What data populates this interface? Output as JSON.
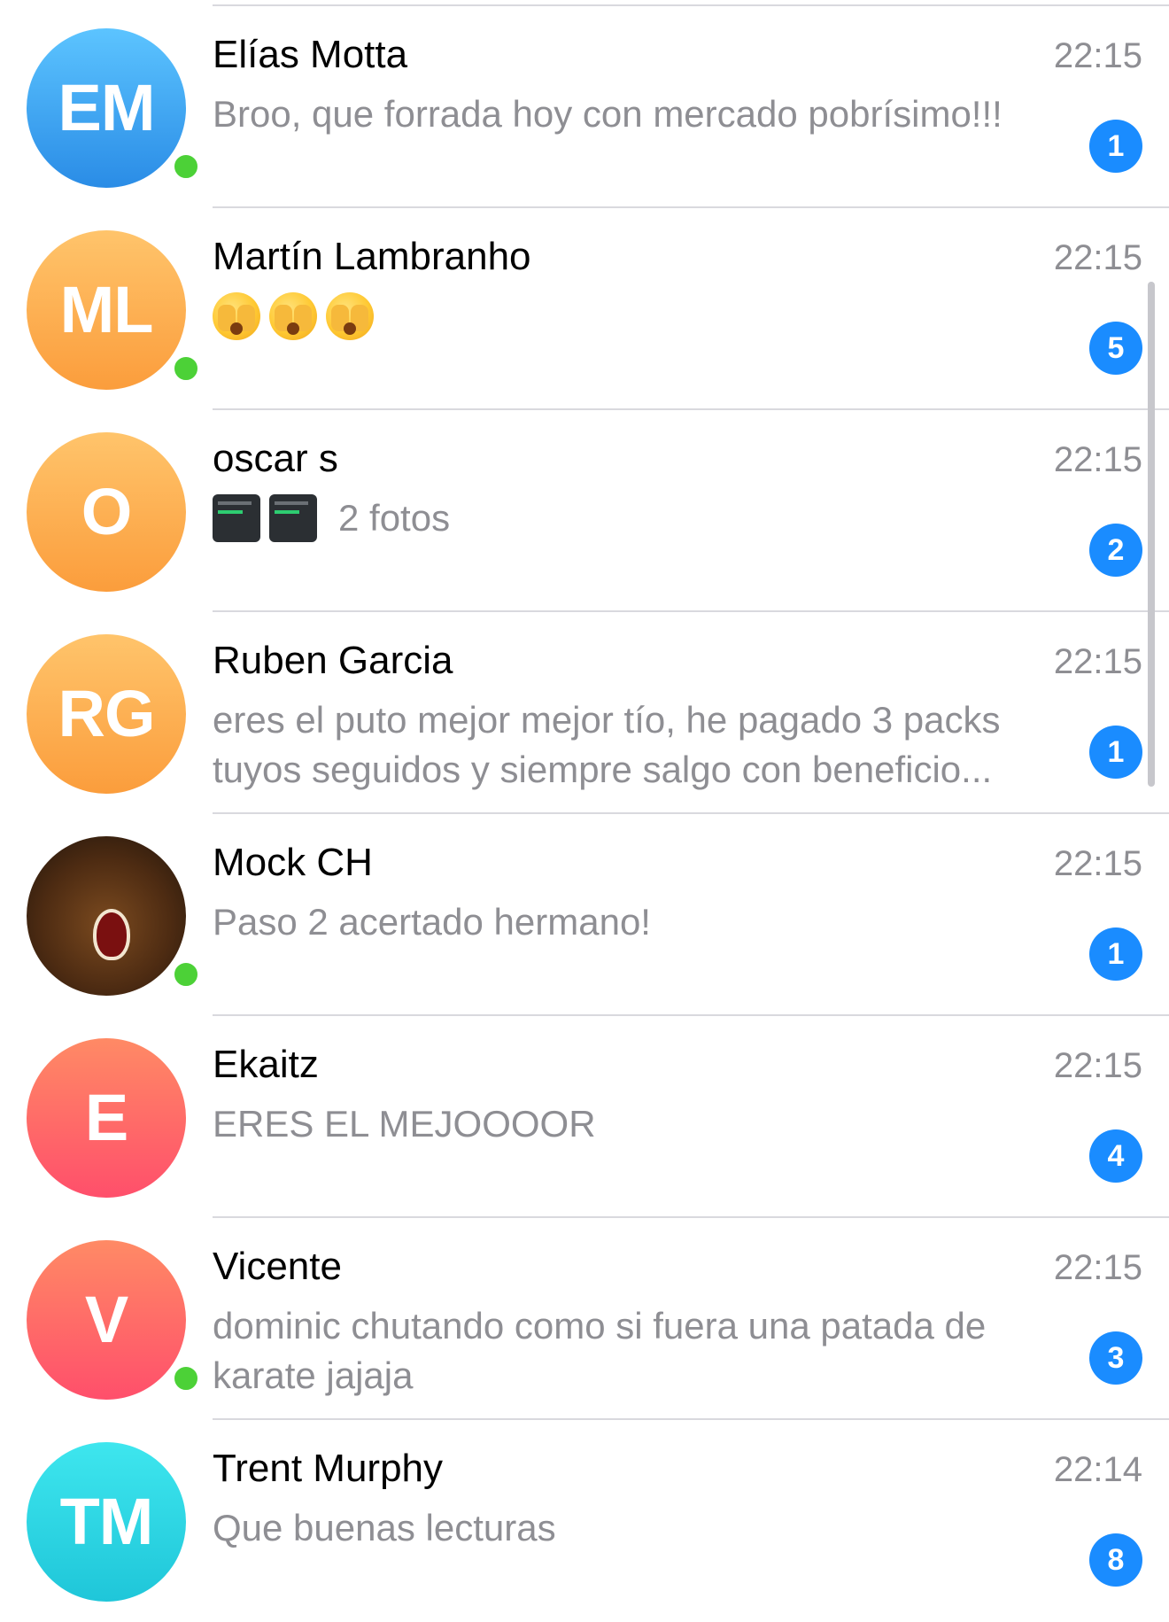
{
  "chats": [
    {
      "name": "Elías Motta",
      "time": "22:15",
      "preview": "Broo, que forrada hoy con mercado pobrísimo!!!",
      "initials": "EM",
      "avatar_color_top": "#5cc4ff",
      "avatar_color_bottom": "#2a8ce6",
      "online": true,
      "unread": "1"
    },
    {
      "name": "Martín Lambranho",
      "time": "22:15",
      "preview_emoji": [
        "face-with-hands-over-eyes-emoji",
        "face-with-hands-over-eyes-emoji",
        "face-with-hands-over-eyes-emoji"
      ],
      "initials": "ML",
      "avatar_color_top": "#ffc46b",
      "avatar_color_bottom": "#fb9d3c",
      "online": true,
      "unread": "5"
    },
    {
      "name": "oscar s",
      "time": "22:15",
      "preview": "2 fotos",
      "preview_thumbnails": 2,
      "initials": "O",
      "avatar_color_top": "#ffc46b",
      "avatar_color_bottom": "#fb9d3c",
      "online": false,
      "unread": "2"
    },
    {
      "name": "Ruben Garcia",
      "time": "22:15",
      "preview": "eres el puto mejor mejor tío, he pagado 3 packs tuyos seguidos y siempre salgo con beneficio...",
      "initials": "RG",
      "avatar_color_top": "#ffc46b",
      "avatar_color_bottom": "#fb9d3c",
      "online": false,
      "unread": "1"
    },
    {
      "name": "Mock CH",
      "time": "22:15",
      "preview": "Paso 2 acertado hermano!",
      "initials": "",
      "avatar_image": "roaring-lion-photo",
      "online": true,
      "unread": "1"
    },
    {
      "name": "Ekaitz",
      "time": "22:15",
      "preview": "ERES EL MEJOOOOR",
      "initials": "E",
      "avatar_color_top": "#ff8a65",
      "avatar_color_bottom": "#ff4f6b",
      "online": false,
      "unread": "4"
    },
    {
      "name": "Vicente",
      "time": "22:15",
      "preview": "dominic chutando como si fuera una patada de karate jajaja",
      "initials": "V",
      "avatar_color_top": "#ff8a65",
      "avatar_color_bottom": "#ff4f6b",
      "online": true,
      "unread": "3"
    },
    {
      "name": "Trent Murphy",
      "time": "22:14",
      "preview": "Que buenas lecturas",
      "initials": "TM",
      "avatar_color_top": "#3ee6ee",
      "avatar_color_bottom": "#1fc6d9",
      "online": false,
      "unread": "8"
    }
  ],
  "colors": {
    "badge": "#1a8cff",
    "online": "#4cd137",
    "preview_text": "#8e8e93",
    "divider": "#d9d9de"
  }
}
